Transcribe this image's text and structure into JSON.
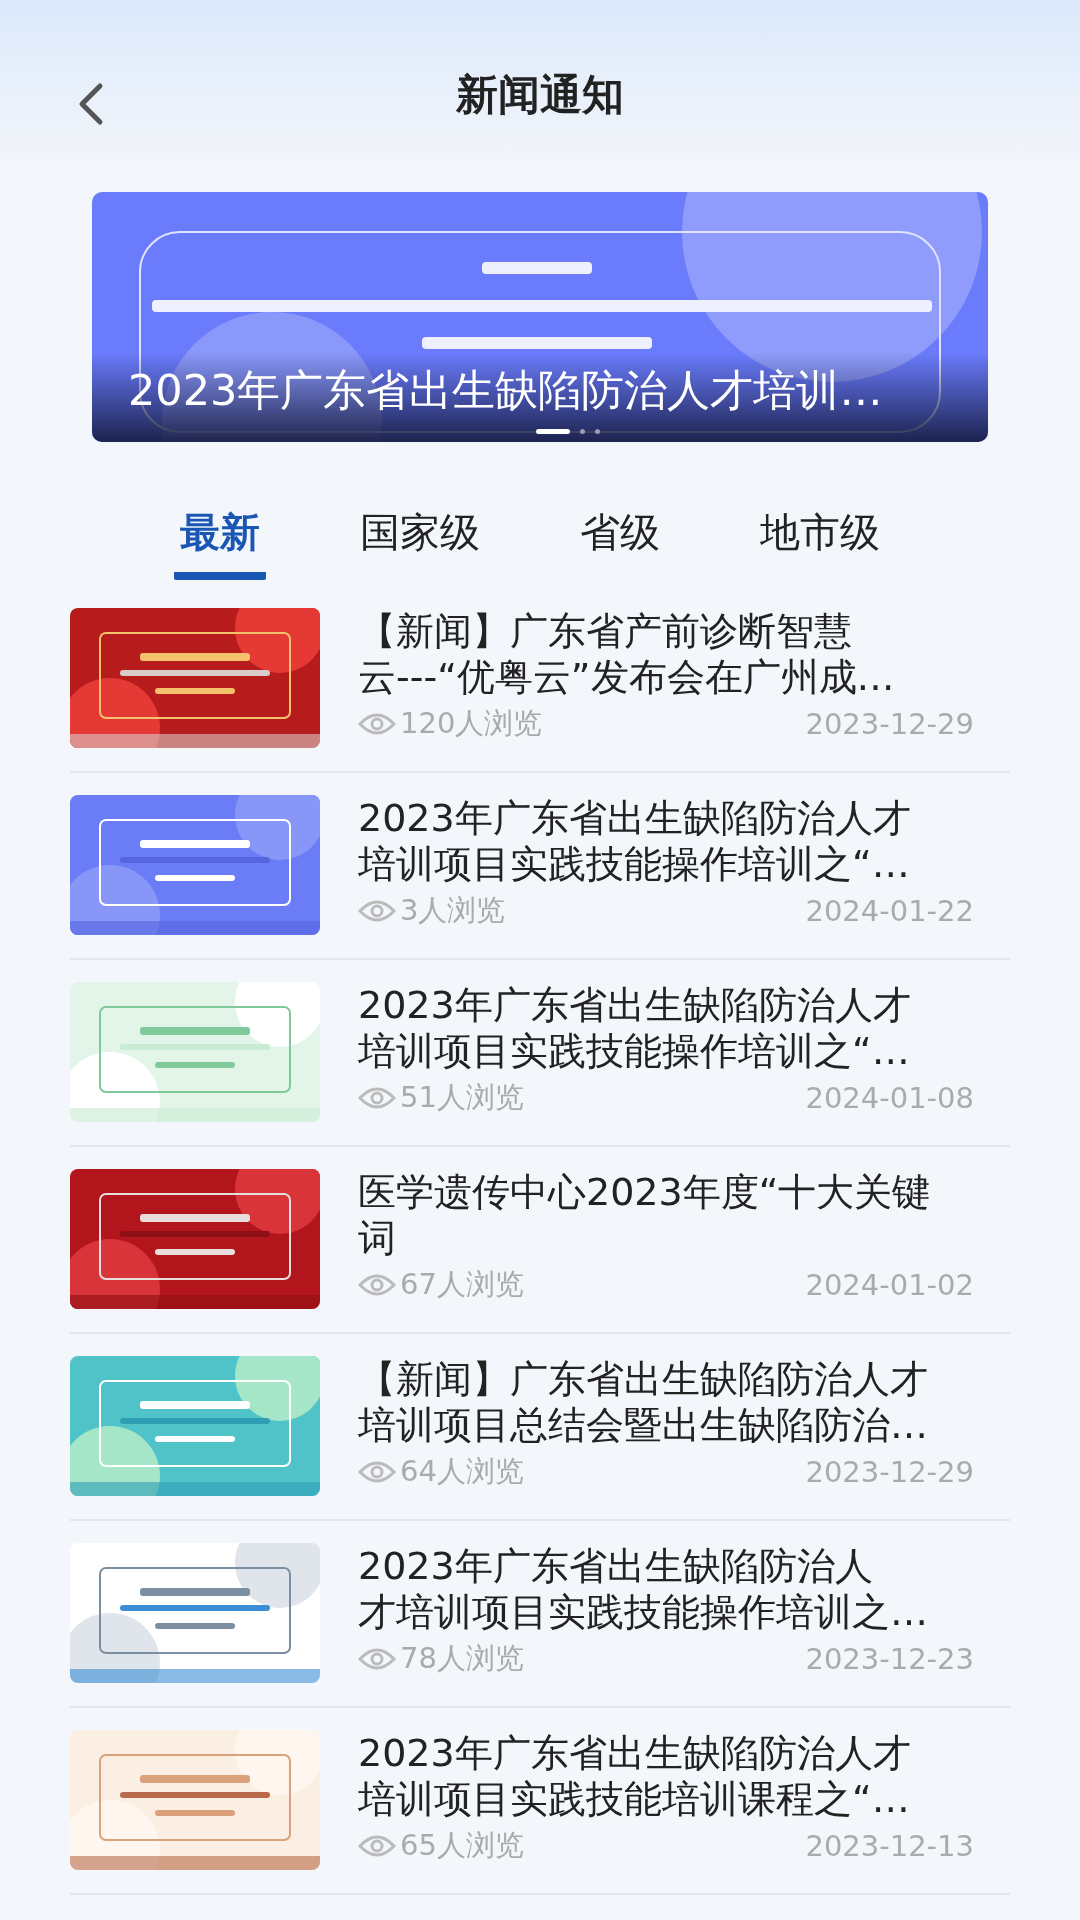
{
  "header": {
    "title": "新闻通知"
  },
  "banner": {
    "caption": "2023年广东省出生缺陷防治人才培训…",
    "dots": [
      {
        "selected": true
      },
      {
        "selected": false
      },
      {
        "selected": false
      }
    ]
  },
  "tabs": [
    {
      "label": "最新",
      "selected": true
    },
    {
      "label": "国家级",
      "selected": false
    },
    {
      "label": "省级",
      "selected": false
    },
    {
      "label": "地市级",
      "selected": false
    }
  ],
  "news": [
    {
      "title_lines": [
        "【新闻】广东省产前诊断智慧",
        "云---“优粤云”发布会在广州成…"
      ],
      "views": "120人浏览",
      "date": "2023-12-29"
    },
    {
      "title_lines": [
        "2023年广东省出生缺陷防治人才",
        "培训项目实践技能操作培训之“…"
      ],
      "views": "3人浏览",
      "date": "2024-01-22"
    },
    {
      "title_lines": [
        "2023年广东省出生缺陷防治人才",
        "培训项目实践技能操作培训之“…"
      ],
      "views": "51人浏览",
      "date": "2024-01-08"
    },
    {
      "title_lines": [
        "医学遗传中心2023年度“十大关键",
        "词"
      ],
      "views": "67人浏览",
      "date": "2024-01-02"
    },
    {
      "title_lines": [
        "【新闻】广东省出生缺陷防治人才",
        "培训项目总结会暨出生缺陷防治…"
      ],
      "views": "64人浏览",
      "date": "2023-12-29"
    },
    {
      "title_lines": [
        "2023年广东省出生缺陷防治人",
        "才培训项目实践技能操作培训之…"
      ],
      "views": "78人浏览",
      "date": "2023-12-23"
    },
    {
      "title_lines": [
        "2023年广东省出生缺陷防治人才",
        "培训项目实践技能培训课程之“…"
      ],
      "views": "65人浏览",
      "date": "2023-12-13"
    }
  ]
}
